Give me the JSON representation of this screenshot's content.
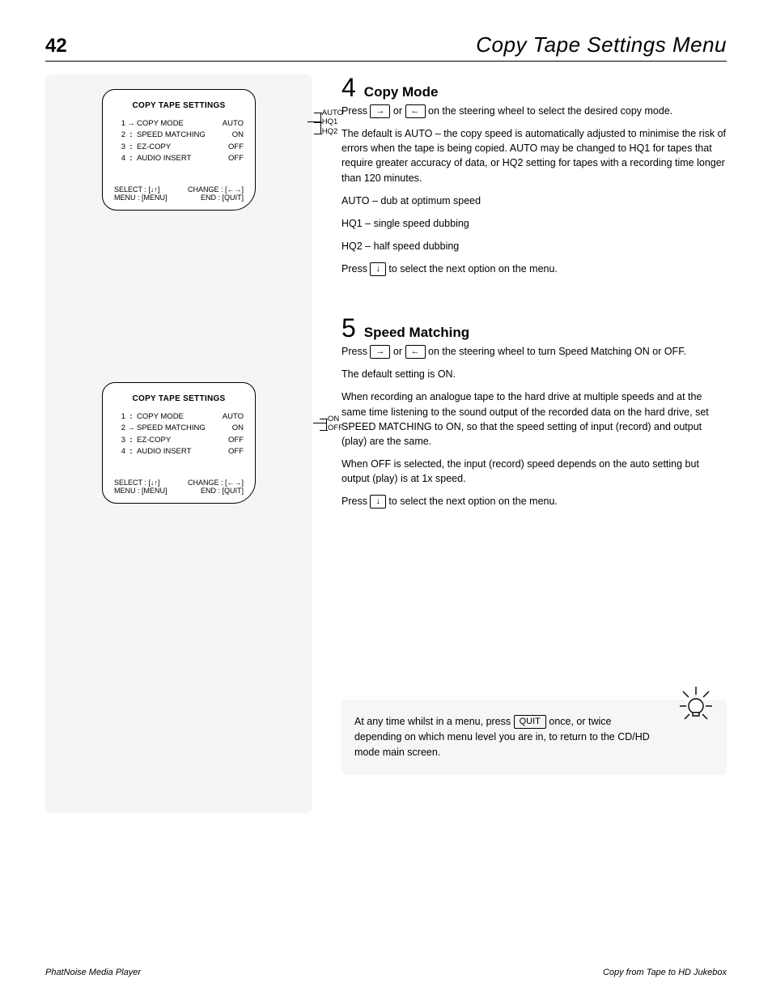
{
  "header": {
    "page_number": "42",
    "title": "Copy Tape Settings Menu"
  },
  "lhs": {
    "screens": [
      {
        "title": "COPY TAPE SETTINGS",
        "rows": [
          {
            "idx": "1",
            "sep": "→",
            "label": "COPY MODE",
            "value": "AUTO",
            "connector": true
          },
          {
            "idx": "2",
            "sep": ":",
            "label": "SPEED MATCHING",
            "value": "ON"
          },
          {
            "idx": "3",
            "sep": ":",
            "label": "EZ-COPY",
            "value": "OFF"
          },
          {
            "idx": "4",
            "sep": ":",
            "label": "AUDIO INSERT",
            "value": "OFF"
          }
        ],
        "side_options": [
          "AUTO",
          "HQ1",
          "HQ2"
        ],
        "nav": {
          "select": "SELECT : [↓↑]",
          "change": "CHANGE : [←→]",
          "menu": "MENU : [MENU]",
          "end": "END : [QUIT]"
        }
      },
      {
        "title": "COPY TAPE SETTINGS",
        "rows": [
          {
            "idx": "1",
            "sep": ":",
            "label": "COPY MODE",
            "value": "AUTO"
          },
          {
            "idx": "2",
            "sep": "→",
            "label": "SPEED MATCHING",
            "value": "ON",
            "connector": true
          },
          {
            "idx": "3",
            "sep": ":",
            "label": "EZ-COPY",
            "value": "OFF"
          },
          {
            "idx": "4",
            "sep": ":",
            "label": "AUDIO INSERT",
            "value": "OFF"
          }
        ],
        "side_options": [
          "ON",
          "OFF"
        ],
        "nav": {
          "select": "SELECT : [↓↑]",
          "change": "CHANGE : [←→]",
          "menu": "MENU : [MENU]",
          "end": "END : [QUIT]"
        }
      }
    ]
  },
  "rhs": {
    "sections": [
      {
        "num": "4",
        "title": "Copy Mode",
        "paras": [
          {
            "pre": "Press ",
            "btn": "→",
            "post": " or ",
            "btn2": "←",
            "post2": " on the steering wheel to select the desired copy mode."
          },
          {
            "text": "The default is AUTO – the copy speed is automatically adjusted to minimise the risk of errors when the tape is being copied. AUTO may be changed to HQ1 for tapes that require greater accuracy of data, or HQ2 setting for tapes with a recording time longer than 120 minutes."
          }
        ],
        "lines": [
          "AUTO – dub at optimum speed",
          "HQ1 – single speed dubbing",
          "HQ2 – half speed dubbing"
        ],
        "trailer": {
          "pre": "Press ",
          "btn": "↓",
          "post": " to select the next option on the menu."
        }
      },
      {
        "num": "5",
        "title": "Speed Matching",
        "paras": [
          {
            "pre": "Press ",
            "btn": "→",
            "post": " or ",
            "btn2": "←",
            "post2": " on the steering wheel to turn Speed Matching ON or OFF."
          },
          {
            "text": "The default setting is ON."
          },
          {
            "text": "When recording an analogue tape to the hard drive at multiple speeds and at the same time listening to the sound output of the recorded data on the hard drive, set SPEED MATCHING to ON, so that the speed setting of input (record) and output (play) are the same."
          },
          {
            "text": "When OFF is selected, the input (record) speed depends on the auto setting but output (play) is at 1x speed."
          }
        ],
        "trailer": {
          "pre": "Press ",
          "btn": "↓",
          "post": " to select the next option on the menu."
        }
      }
    ],
    "callout": {
      "pre": "At any time whilst in a menu, press ",
      "btn": "QUIT",
      "mid": " once, or twice depending on which menu level you are in, to return to the CD/HD mode main screen."
    }
  },
  "footer": {
    "left": "PhatNoise Media Player",
    "right": "Copy from Tape to HD Jukebox"
  }
}
